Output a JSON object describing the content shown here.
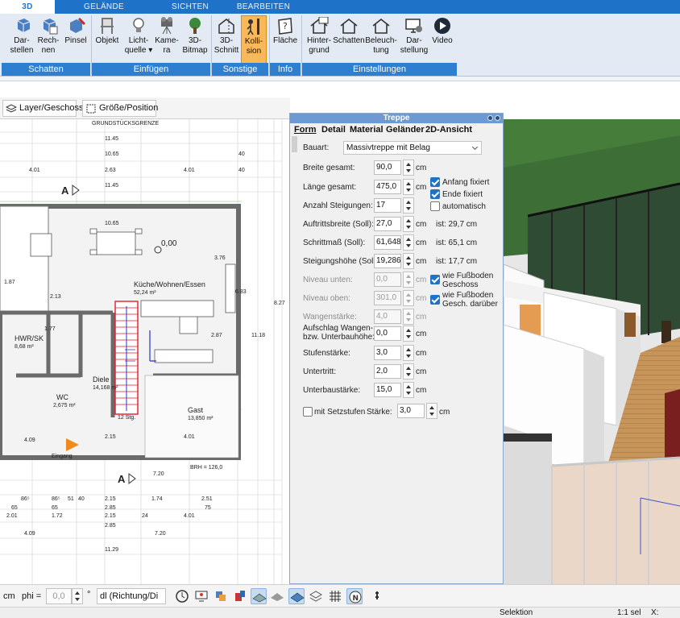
{
  "ribbon": {
    "tabs": [
      {
        "label": "3D",
        "active": true
      },
      {
        "label": "GELÄNDE"
      },
      {
        "label": "SICHTEN"
      },
      {
        "label": "BEARBEITEN"
      }
    ],
    "groups": {
      "schatten": "Schatten",
      "einfuegen": "Einfügen",
      "sonstige": "Sonstige",
      "info": "Info",
      "einstellungen": "Einstellungen"
    },
    "buttons": {
      "darstellen": "Dar-\nstellen",
      "rechnen": "Rech-\nnen",
      "pinsel": "Pinsel",
      "objekt": "Objekt",
      "lichtquelle": "Licht-\nquelle ▾",
      "kamera": "Kame-\nra",
      "bitmap": "3D-\nBitmap",
      "schnitt": "3D-\nSchnitt",
      "kollision": "Kolli-\nsion",
      "flaeche": "Fläche",
      "hintergrund": "Hinter-\ngrund",
      "schatten": "Schatten",
      "beleuchtung": "Beleuch-\ntung",
      "darstellung": "Dar-\nstellung",
      "video": "Video"
    }
  },
  "plan_toolbar": {
    "layer": "Layer/Geschoss",
    "groesse": "Größe/Position"
  },
  "plan": {
    "header": "GRUNDSTÜCKSGRENZE",
    "dims_top": [
      "11.45",
      "10.65",
      "4.01",
      "2.63",
      "4.01",
      "40",
      "40",
      "11.45",
      "10.65"
    ],
    "rooms": [
      {
        "name": "Küche/Wohnen/Essen",
        "area": "52,24 m²"
      },
      {
        "name": "HWR/SK",
        "area": "8,68 m²"
      },
      {
        "name": "Diele",
        "area": "14,168 m²"
      },
      {
        "name": "Gast",
        "area": "13,850 m²"
      },
      {
        "name": "WC",
        "area": "2,675 m²"
      },
      {
        "name": "Eingang",
        "area": ""
      }
    ],
    "level_mark": "0,00",
    "section_letter": "A",
    "dims_bottom": [
      "86⁵",
      "86⁵",
      "51",
      "40",
      "2.15",
      "1.74",
      "2.51",
      "65",
      "65",
      "2.85",
      "75",
      "2.01",
      "1.72",
      "2.15",
      "24",
      "4.01",
      "2.85",
      "4.09",
      "7.20",
      "11.29"
    ],
    "misc": [
      "7.20",
      "4.09",
      "2.15",
      "4.01",
      "BRH = 126,0",
      "1.87",
      "2.13",
      "1.77",
      "3.76",
      "11.18",
      "8.27",
      "6.83",
      "2.87",
      "12 Stg."
    ]
  },
  "dialog": {
    "title": "Treppe",
    "tabs": [
      "Form",
      "Detail",
      "Material",
      "Geländer",
      "2D-Ansicht"
    ],
    "bauart_label": "Bauart:",
    "bauart_value": "Massivtreppe mit Belag",
    "fields": [
      {
        "label": "Breite gesamt:",
        "value": "90,0",
        "unit": "cm",
        "disabled": false
      },
      {
        "label": "Länge gesamt:",
        "value": "475,0",
        "unit": "cm",
        "disabled": false
      },
      {
        "label": "Anzahl Steigungen:",
        "value": "17",
        "unit": "",
        "disabled": false
      },
      {
        "label": "Auftrittsbreite (Soll):",
        "value": "27,0",
        "unit": "cm",
        "extra": "ist: 29,7 cm",
        "disabled": false
      },
      {
        "label": "Schrittmaß (Soll):",
        "value": "61,648",
        "unit": "cm",
        "extra": "ist: 65,1 cm",
        "disabled": false
      },
      {
        "label": "Steigungshöhe (Soll):",
        "value": "19,286",
        "unit": "cm",
        "extra": "ist: 17,7 cm",
        "disabled": false
      },
      {
        "label": "Niveau unten:",
        "value": "0,0",
        "unit": "cm",
        "disabled": true
      },
      {
        "label": "Niveau oben:",
        "value": "301,0",
        "unit": "cm",
        "disabled": true
      },
      {
        "label": "Wangenstärke:",
        "value": "4,0",
        "unit": "cm",
        "disabled": true
      },
      {
        "label": "Aufschlag Wangen-\nbzw. Unterbauhöhe:",
        "value": "0,0",
        "unit": "cm",
        "disabled": false
      },
      {
        "label": "Stufenstärke:",
        "value": "3,0",
        "unit": "cm",
        "disabled": false
      },
      {
        "label": "Untertritt:",
        "value": "2,0",
        "unit": "cm",
        "disabled": false
      },
      {
        "label": "Unterbaustärke:",
        "value": "15,0",
        "unit": "cm",
        "disabled": false
      }
    ],
    "checks": {
      "anfang": {
        "label": "Anfang fixiert",
        "checked": true
      },
      "ende": {
        "label": "Ende fixiert",
        "checked": true
      },
      "automatisch": {
        "label": "automatisch",
        "checked": false
      },
      "fussboden_unten": {
        "label": "wie Fußboden\nGeschoss",
        "checked": true
      },
      "fussboden_oben": {
        "label": "wie Fußboden\nGesch. darüber",
        "checked": true
      },
      "setzstufen": {
        "label": "mit Setzstufen",
        "checked": false
      }
    },
    "staerke_label": "Stärke:",
    "staerke_value": "3,0",
    "staerke_unit": "cm"
  },
  "bottom_bar": {
    "cm": "cm",
    "phi_label": "phi =",
    "phi_value": "0,0",
    "degree": "°",
    "dl_select": "dl (Richtung/Di"
  },
  "status": {
    "selektion": "Selektion",
    "scale": "1:1 sel",
    "x": "X:"
  },
  "colors": {
    "ribbon_blue": "#1e73c8",
    "active_button": "#f9b95a",
    "stair_red": "#e8192c",
    "stair_blue": "#2233cc"
  }
}
